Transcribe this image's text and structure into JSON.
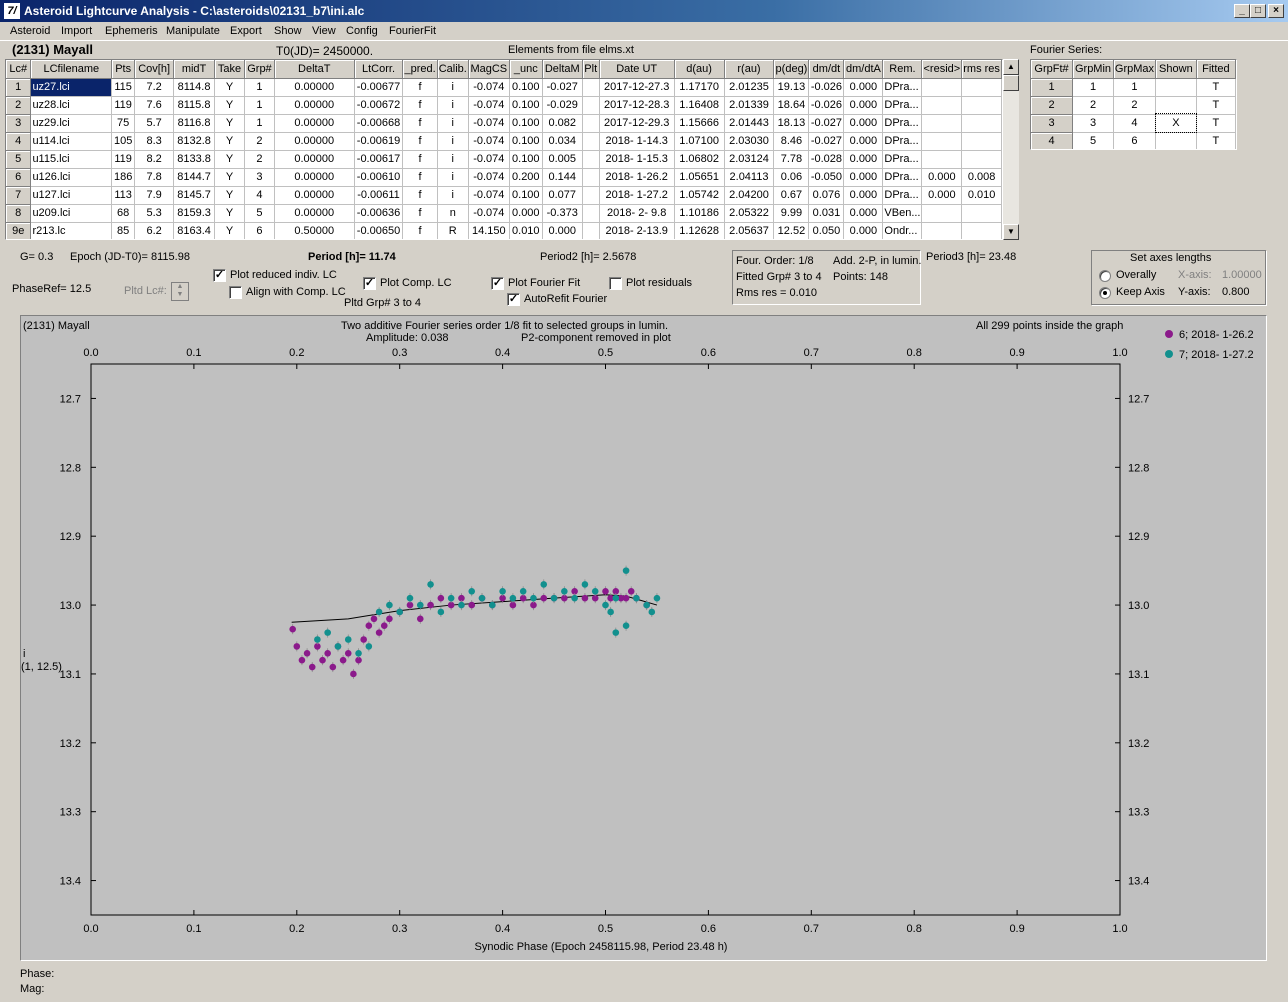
{
  "window": {
    "title": "Asteroid Lightcurve Analysis - C:\\asteroids\\02131_b7\\ini.alc",
    "icon": "7/"
  },
  "menu": [
    "Asteroid",
    "Import",
    "Ephemeris",
    "Manipulate",
    "Export",
    "Show",
    "View",
    "Config",
    "FourierFit"
  ],
  "header": {
    "asteroid": "(2131) Mayall",
    "t0": "T0(JD)= 2450000.",
    "elements": "Elements from file elms.xt",
    "fourier_title": "Fourier Series:"
  },
  "lc_table": {
    "columns": [
      "Lc#",
      "LCfilename",
      "Pts",
      "Cov[h]",
      "midT",
      "Take",
      "Grp#",
      "DeltaT",
      "LtCorr.",
      "_pred.",
      "Calib.",
      "MagCS",
      "_unc",
      "DeltaM",
      "Plt",
      "Date UT",
      "d(au)",
      "r(au)",
      "p(deg)",
      "dm/dt",
      "dm/dtA",
      "Rem.",
      "<resid>",
      "rms res"
    ],
    "rows": [
      [
        "1",
        "uz27.lci",
        "115",
        "7.2",
        "8114.8",
        "Y",
        "1",
        "0.00000",
        "-0.00677",
        "f",
        "i",
        "-0.074",
        "0.100",
        "-0.027",
        "",
        "2017-12-27.3",
        "1.17170",
        "2.01235",
        "19.13",
        "-0.026",
        "0.000",
        "DPra...",
        "",
        ""
      ],
      [
        "2",
        "uz28.lci",
        "119",
        "7.6",
        "8115.8",
        "Y",
        "1",
        "0.00000",
        "-0.00672",
        "f",
        "i",
        "-0.074",
        "0.100",
        "-0.029",
        "",
        "2017-12-28.3",
        "1.16408",
        "2.01339",
        "18.64",
        "-0.026",
        "0.000",
        "DPra...",
        "",
        ""
      ],
      [
        "3",
        "uz29.lci",
        "75",
        "5.7",
        "8116.8",
        "Y",
        "1",
        "0.00000",
        "-0.00668",
        "f",
        "i",
        "-0.074",
        "0.100",
        "0.082",
        "",
        "2017-12-29.3",
        "1.15666",
        "2.01443",
        "18.13",
        "-0.027",
        "0.000",
        "DPra...",
        "",
        ""
      ],
      [
        "4",
        "u114.lci",
        "105",
        "8.3",
        "8132.8",
        "Y",
        "2",
        "0.00000",
        "-0.00619",
        "f",
        "i",
        "-0.074",
        "0.100",
        "0.034",
        "",
        "2018- 1-14.3",
        "1.07100",
        "2.03030",
        "8.46",
        "-0.027",
        "0.000",
        "DPra...",
        "",
        ""
      ],
      [
        "5",
        "u115.lci",
        "119",
        "8.2",
        "8133.8",
        "Y",
        "2",
        "0.00000",
        "-0.00617",
        "f",
        "i",
        "-0.074",
        "0.100",
        "0.005",
        "",
        "2018- 1-15.3",
        "1.06802",
        "2.03124",
        "7.78",
        "-0.028",
        "0.000",
        "DPra...",
        "",
        ""
      ],
      [
        "6",
        "u126.lci",
        "186",
        "7.8",
        "8144.7",
        "Y",
        "3",
        "0.00000",
        "-0.00610",
        "f",
        "i",
        "-0.074",
        "0.200",
        "0.144",
        "",
        "2018- 1-26.2",
        "1.05651",
        "2.04113",
        "0.06",
        "-0.050",
        "0.000",
        "DPra...",
        "0.000",
        "0.008"
      ],
      [
        "7",
        "u127.lci",
        "113",
        "7.9",
        "8145.7",
        "Y",
        "4",
        "0.00000",
        "-0.00611",
        "f",
        "i",
        "-0.074",
        "0.100",
        "0.077",
        "",
        "2018- 1-27.2",
        "1.05742",
        "2.04200",
        "0.67",
        "0.076",
        "0.000",
        "DPra...",
        "0.000",
        "0.010"
      ],
      [
        "8",
        "u209.lci",
        "68",
        "5.3",
        "8159.3",
        "Y",
        "5",
        "0.00000",
        "-0.00636",
        "f",
        "n",
        "-0.074",
        "0.000",
        "-0.373",
        "",
        "2018- 2- 9.8",
        "1.10186",
        "2.05322",
        "9.99",
        "0.031",
        "0.000",
        "VBen...",
        "",
        ""
      ],
      [
        "9e",
        "r213.lc",
        "85",
        "6.2",
        "8163.4",
        "Y",
        "6",
        "0.50000",
        "-0.00650",
        "f",
        "R",
        "14.150",
        "0.010",
        "0.000",
        "",
        "2018- 2-13.9",
        "1.12628",
        "2.05637",
        "12.52",
        "0.050",
        "0.000",
        "Ondr...",
        "",
        ""
      ]
    ]
  },
  "fourier_table": {
    "columns": [
      "GrpFt#",
      "GrpMin",
      "GrpMax",
      "Shown",
      "Fitted"
    ],
    "rows": [
      [
        "1",
        "1",
        "1",
        "",
        "T"
      ],
      [
        "2",
        "2",
        "2",
        "",
        "T"
      ],
      [
        "3",
        "3",
        "4",
        "X",
        "T"
      ],
      [
        "4",
        "5",
        "6",
        "",
        "T"
      ]
    ]
  },
  "params": {
    "g": "G= 0.3",
    "epoch": "Epoch (JD-T0)= 8115.98",
    "period": "Period [h]= 11.74",
    "period2": "Period2 [h]= 2.5678",
    "period3": "Period3 [h]= 23.48",
    "phaseref": "PhaseRef= 12.5",
    "pltd_lc": "Pltd Lc#:",
    "pltd_grp": "Pltd Grp#  3  to  4",
    "fourier_info": {
      "order": "Four. Order:  1/8",
      "add": "Add. 2-P, in lumin.",
      "fitted": "Fitted Grp# 3 to 4",
      "points": "Points: 148",
      "rms": "Rms res     = 0.010"
    }
  },
  "checkboxes": [
    {
      "label": "Plot reduced indiv. LC",
      "checked": true
    },
    {
      "label": "Align with Comp. LC",
      "checked": false
    },
    {
      "label": "Plot Comp. LC",
      "checked": true
    },
    {
      "label": "Plot Fourier Fit",
      "checked": true
    },
    {
      "label": "Plot residuals",
      "checked": false
    },
    {
      "label": "AutoRefit Fourier",
      "checked": true
    }
  ],
  "axes_box": {
    "title": "Set axes lengths",
    "overally": "Overally",
    "keep_axis": "Keep Axis",
    "xaxis_label": "X-axis:",
    "xaxis_val": "1.00000",
    "yaxis_label": "Y-axis:",
    "yaxis_val": "0.800"
  },
  "plot": {
    "top_left": "(2131) Mayall",
    "title1": "Two additive Fourier series order 1/8 fit to selected groups in lumin.",
    "title2a": "Amplitude: 0.038",
    "title2b": "P2-component removed in plot",
    "top_right": "All 299 points inside the graph",
    "ylabel": "i",
    "ylabel2": "(1, 12.5)",
    "xlabel": "Synodic Phase (Epoch 2458115.98, Period 23.48 h)",
    "legend": [
      {
        "label": "6; 2018- 1-26.2",
        "color": "#8b1a8b"
      },
      {
        "label": "7; 2018- 1-27.2",
        "color": "#12908e"
      }
    ]
  },
  "chart_data": {
    "type": "scatter",
    "xlabel": "Synodic Phase (Epoch 2458115.98, Period 23.48 h)",
    "ylabel": "i",
    "xlim": [
      0,
      1
    ],
    "ylim": [
      13.45,
      12.65
    ],
    "x_ticks": [
      "0.0",
      "0.1",
      "0.2",
      "0.3",
      "0.4",
      "0.5",
      "0.6",
      "0.7",
      "0.8",
      "0.9",
      "1.0"
    ],
    "y_ticks": [
      "12.7",
      "12.8",
      "12.9",
      "13.0",
      "13.1",
      "13.2",
      "13.3",
      "13.4"
    ],
    "series": [
      {
        "name": "6; 2018- 1-26.2",
        "color": "#8b1a8b",
        "points": [
          [
            0.196,
            13.035
          ],
          [
            0.2,
            13.06
          ],
          [
            0.205,
            13.08
          ],
          [
            0.21,
            13.07
          ],
          [
            0.215,
            13.09
          ],
          [
            0.22,
            13.06
          ],
          [
            0.225,
            13.08
          ],
          [
            0.23,
            13.07
          ],
          [
            0.235,
            13.09
          ],
          [
            0.24,
            13.06
          ],
          [
            0.245,
            13.08
          ],
          [
            0.25,
            13.07
          ],
          [
            0.255,
            13.1
          ],
          [
            0.26,
            13.08
          ],
          [
            0.265,
            13.05
          ],
          [
            0.27,
            13.03
          ],
          [
            0.275,
            13.02
          ],
          [
            0.28,
            13.04
          ],
          [
            0.285,
            13.03
          ],
          [
            0.29,
            13.02
          ],
          [
            0.3,
            13.01
          ],
          [
            0.31,
            13.0
          ],
          [
            0.32,
            13.02
          ],
          [
            0.33,
            13.0
          ],
          [
            0.34,
            12.99
          ],
          [
            0.35,
            13.0
          ],
          [
            0.36,
            12.99
          ],
          [
            0.37,
            13.0
          ],
          [
            0.38,
            12.99
          ],
          [
            0.39,
            13.0
          ],
          [
            0.4,
            12.99
          ],
          [
            0.41,
            13.0
          ],
          [
            0.42,
            12.99
          ],
          [
            0.43,
            13.0
          ],
          [
            0.44,
            12.99
          ],
          [
            0.45,
            12.99
          ],
          [
            0.46,
            12.99
          ],
          [
            0.47,
            12.98
          ],
          [
            0.48,
            12.99
          ],
          [
            0.49,
            12.99
          ],
          [
            0.5,
            12.98
          ],
          [
            0.505,
            12.99
          ],
          [
            0.51,
            12.98
          ],
          [
            0.515,
            12.99
          ],
          [
            0.52,
            12.99
          ],
          [
            0.525,
            12.98
          ],
          [
            0.53,
            12.99
          ],
          [
            0.54,
            13.0
          ]
        ]
      },
      {
        "name": "7; 2018- 1-27.2",
        "color": "#12908e",
        "points": [
          [
            0.22,
            13.05
          ],
          [
            0.23,
            13.04
          ],
          [
            0.24,
            13.06
          ],
          [
            0.25,
            13.05
          ],
          [
            0.26,
            13.07
          ],
          [
            0.27,
            13.06
          ],
          [
            0.28,
            13.01
          ],
          [
            0.29,
            13.0
          ],
          [
            0.3,
            13.01
          ],
          [
            0.31,
            12.99
          ],
          [
            0.32,
            13.0
          ],
          [
            0.33,
            12.97
          ],
          [
            0.34,
            13.01
          ],
          [
            0.35,
            12.99
          ],
          [
            0.36,
            13.0
          ],
          [
            0.37,
            12.98
          ],
          [
            0.38,
            12.99
          ],
          [
            0.39,
            13.0
          ],
          [
            0.4,
            12.98
          ],
          [
            0.41,
            12.99
          ],
          [
            0.42,
            12.98
          ],
          [
            0.43,
            12.99
          ],
          [
            0.44,
            12.97
          ],
          [
            0.45,
            12.99
          ],
          [
            0.46,
            12.98
          ],
          [
            0.47,
            12.99
          ],
          [
            0.48,
            12.97
          ],
          [
            0.49,
            12.98
          ],
          [
            0.5,
            13.0
          ],
          [
            0.51,
            12.99
          ],
          [
            0.52,
            12.95
          ],
          [
            0.53,
            12.99
          ],
          [
            0.54,
            13.0
          ],
          [
            0.545,
            13.01
          ],
          [
            0.55,
            12.99
          ],
          [
            0.505,
            13.01
          ],
          [
            0.51,
            13.04
          ],
          [
            0.52,
            13.03
          ]
        ]
      }
    ],
    "fit_curve": [
      [
        0.195,
        13.025
      ],
      [
        0.25,
        13.02
      ],
      [
        0.3,
        13.008
      ],
      [
        0.35,
        13.0
      ],
      [
        0.4,
        12.995
      ],
      [
        0.45,
        12.99
      ],
      [
        0.5,
        12.985
      ],
      [
        0.52,
        12.987
      ],
      [
        0.55,
        13.0
      ]
    ]
  },
  "status": {
    "phase": "Phase:",
    "mag": "Mag:"
  }
}
